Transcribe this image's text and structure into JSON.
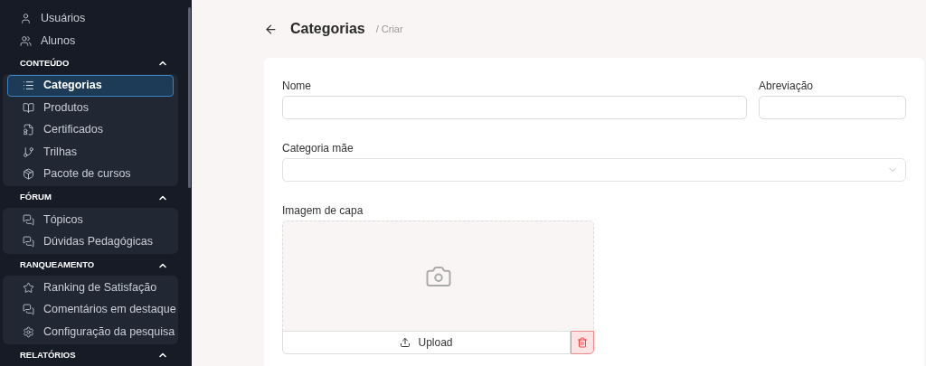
{
  "sidebar": {
    "top_items": [
      {
        "label": "Usuários",
        "selected": false
      },
      {
        "label": "Alunos",
        "selected": false
      }
    ],
    "sections": [
      {
        "title": "CONTEÚDO",
        "expanded": true,
        "items": [
          {
            "label": "Categorias",
            "selected": true
          },
          {
            "label": "Produtos",
            "selected": false
          },
          {
            "label": "Certificados",
            "selected": false
          },
          {
            "label": "Trilhas",
            "selected": false
          },
          {
            "label": "Pacote de cursos",
            "selected": false
          }
        ]
      },
      {
        "title": "FÓRUM",
        "expanded": true,
        "items": [
          {
            "label": "Tópicos",
            "selected": false
          },
          {
            "label": "Dúvidas Pedagógicas",
            "selected": false
          }
        ]
      },
      {
        "title": "RANQUEAMENTO",
        "expanded": true,
        "items": [
          {
            "label": "Ranking de Satisfação",
            "selected": false
          },
          {
            "label": "Comentários em destaque",
            "selected": false
          },
          {
            "label": "Configuração da pesquisa",
            "selected": false
          }
        ]
      },
      {
        "title": "RELATÓRIOS",
        "expanded": true
      }
    ]
  },
  "header": {
    "title": "Categorias",
    "breadcrumb": "/ Criar"
  },
  "form": {
    "name_label": "Nome",
    "abbr_label": "Abreviação",
    "parent_label": "Categoria mãe",
    "image_label": "Imagem de capa",
    "upload_button": "Upload"
  }
}
